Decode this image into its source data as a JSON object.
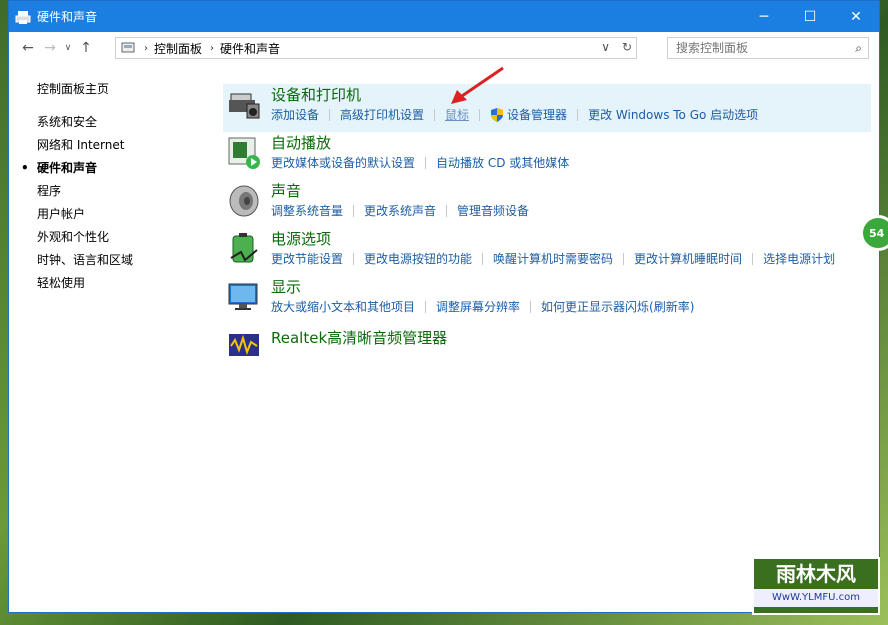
{
  "window": {
    "title": "硬件和声音"
  },
  "address": {
    "crumbs": [
      "控制面板",
      "硬件和声音"
    ]
  },
  "search": {
    "placeholder": "搜索控制面板"
  },
  "sidebar": {
    "items": [
      "控制面板主页",
      "系统和安全",
      "网络和 Internet",
      "硬件和声音",
      "程序",
      "用户帐户",
      "外观和个性化",
      "时钟、语言和区域",
      "轻松使用"
    ]
  },
  "categories": [
    {
      "title": "设备和打印机",
      "links": [
        "添加设备",
        "高级打印机设置",
        "鼠标",
        "设备管理器",
        "更改 Windows To Go 启动选项"
      ]
    },
    {
      "title": "自动播放",
      "links": [
        "更改媒体或设备的默认设置",
        "自动播放 CD 或其他媒体"
      ]
    },
    {
      "title": "声音",
      "links": [
        "调整系统音量",
        "更改系统声音",
        "管理音频设备"
      ]
    },
    {
      "title": "电源选项",
      "links": [
        "更改节能设置",
        "更改电源按钮的功能",
        "唤醒计算机时需要密码",
        "更改计算机睡眠时间",
        "选择电源计划"
      ]
    },
    {
      "title": "显示",
      "links": [
        "放大或缩小文本和其他项目",
        "调整屏幕分辨率",
        "如何更正显示器闪烁(刷新率)"
      ]
    },
    {
      "title": "Realtek高清晰音频管理器",
      "links": []
    }
  ],
  "watermark": {
    "top": "雨林木风",
    "bottom": "WwW.YLMFU.com"
  },
  "badge": {
    "text": "54"
  },
  "colors": {
    "titlebar": "#1a7fe0",
    "category_title": "#0b6a0b",
    "link": "#1c5ea6",
    "highlight": "#e5f3fb"
  }
}
